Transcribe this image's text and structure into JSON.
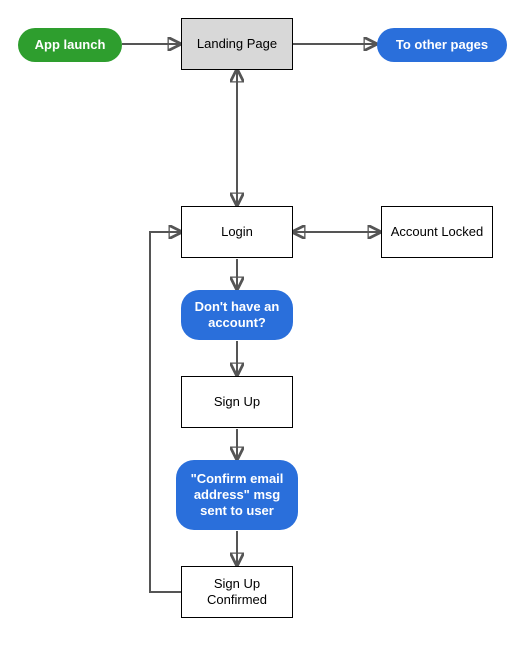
{
  "nodes": {
    "app_launch": {
      "label": "App launch",
      "color": "green"
    },
    "landing_page": {
      "label": "Landing Page"
    },
    "to_other_pages": {
      "label": "To other pages",
      "color": "blue"
    },
    "login": {
      "label": "Login"
    },
    "account_locked": {
      "label": "Account Locked"
    },
    "no_account_q": {
      "label": "Don't have an account?",
      "color": "blue"
    },
    "sign_up": {
      "label": "Sign Up"
    },
    "confirm_email_msg": {
      "label": "\"Confirm email address\" msg sent to user",
      "color": "blue"
    },
    "sign_up_confirmed": {
      "label": "Sign Up Confirmed"
    }
  },
  "edges": [
    {
      "from": "app_launch",
      "to": "landing_page",
      "dir": "one"
    },
    {
      "from": "landing_page",
      "to": "to_other_pages",
      "dir": "one"
    },
    {
      "from": "landing_page",
      "to": "login",
      "dir": "two"
    },
    {
      "from": "login",
      "to": "account_locked",
      "dir": "two"
    },
    {
      "from": "login",
      "to": "no_account_q",
      "dir": "one"
    },
    {
      "from": "no_account_q",
      "to": "sign_up",
      "dir": "one"
    },
    {
      "from": "sign_up",
      "to": "confirm_email_msg",
      "dir": "one"
    },
    {
      "from": "confirm_email_msg",
      "to": "sign_up_confirmed",
      "dir": "one"
    },
    {
      "from": "sign_up_confirmed",
      "to": "login",
      "dir": "one",
      "note": "loop-left"
    }
  ]
}
